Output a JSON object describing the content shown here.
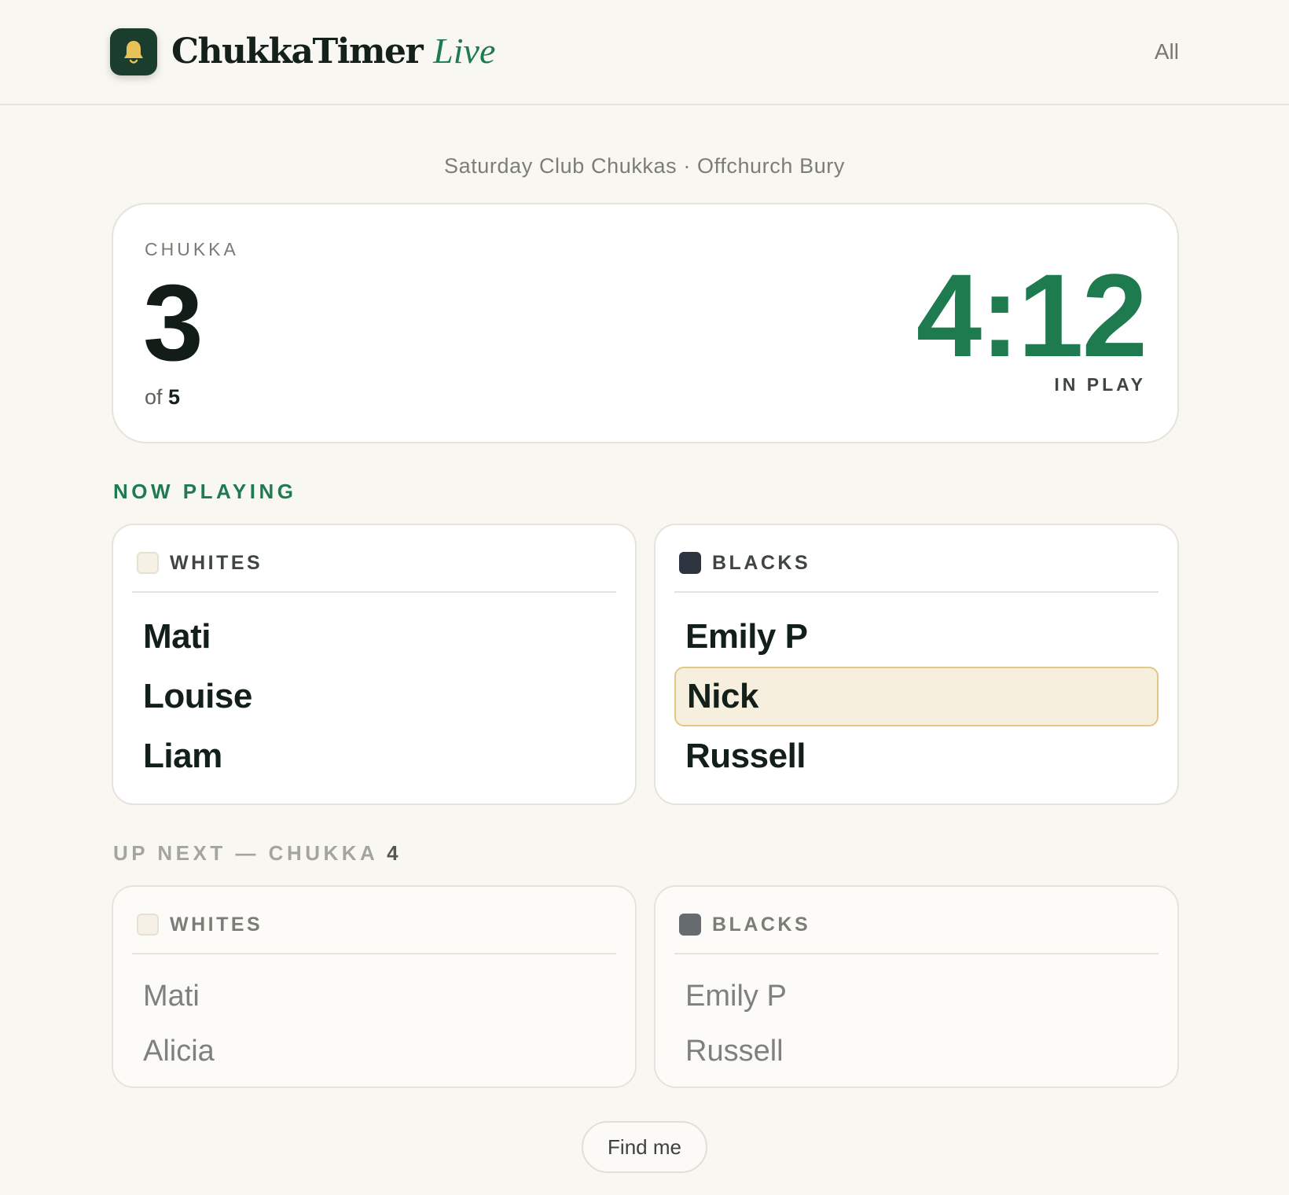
{
  "header": {
    "brand": "ChukkaTimer",
    "brand_suffix": "Live",
    "nav_all": "All",
    "logo_icon": "bell-icon",
    "accent_color": "#1e7a4f",
    "logo_bg": "#1a3d2e",
    "bell_color": "#e8c15a"
  },
  "event": {
    "subtitle": "Saturday Club Chukkas · Offchurch Bury"
  },
  "timer": {
    "chukka_label": "CHUKKA",
    "chukka_number": "3",
    "of_label": "of",
    "total_chukkas": "5",
    "clock": "4:12",
    "state": "IN PLAY"
  },
  "now_playing": {
    "label": "NOW PLAYING",
    "teams": [
      {
        "name": "WHITES",
        "swatch": "#f5f1e6",
        "players": [
          "Mati",
          "Louise",
          "Liam"
        ]
      },
      {
        "name": "BLACKS",
        "swatch": "#2d3440",
        "players": [
          "Emily P",
          "Nick",
          "Russell"
        ],
        "highlighted_player": "Nick"
      }
    ]
  },
  "up_next": {
    "label": "UP NEXT — CHUKKA",
    "chukka_number": "4",
    "teams": [
      {
        "name": "WHITES",
        "swatch": "#f5f1e6",
        "players": [
          "Mati",
          "Alicia"
        ]
      },
      {
        "name": "BLACKS",
        "swatch": "#666b70",
        "players": [
          "Emily P",
          "Russell"
        ]
      }
    ]
  },
  "actions": {
    "find_me": "Find me"
  }
}
